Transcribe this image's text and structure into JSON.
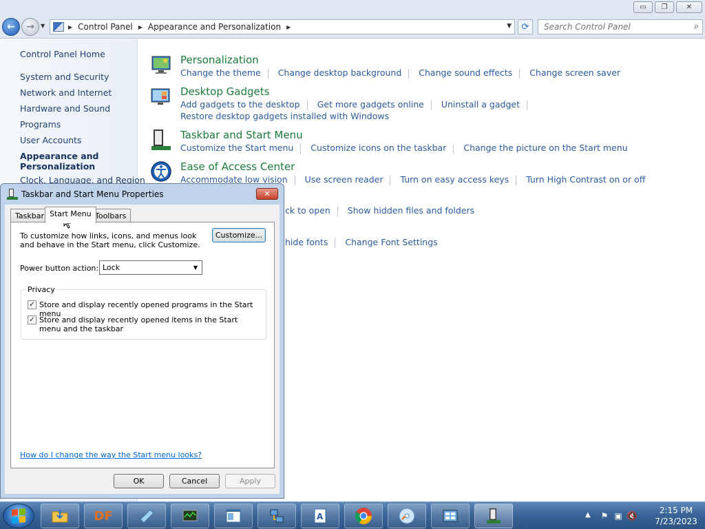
{
  "window": {
    "buttons": {
      "minimize": "▭",
      "restore": "❐",
      "close": "✕"
    }
  },
  "address": {
    "crumbs": [
      "Control Panel",
      "Appearance and Personalization"
    ],
    "search_placeholder": "Search Control Panel"
  },
  "left_pane": {
    "home": "Control Panel Home",
    "items": [
      "System and Security",
      "Network and Internet",
      "Hardware and Sound",
      "Programs",
      "User Accounts"
    ],
    "active_line1": "Appearance and",
    "active_line2": "Personalization",
    "clock_partial": "Clock, Language, and Region"
  },
  "categories": {
    "personalization": {
      "title": "Personalization",
      "links": [
        "Change the theme",
        "Change desktop background",
        "Change sound effects",
        "Change screen saver"
      ]
    },
    "gadgets": {
      "title": "Desktop Gadgets",
      "links": [
        "Add gadgets to the desktop",
        "Get more gadgets online",
        "Uninstall a gadget"
      ],
      "links2": "Restore desktop gadgets installed with Windows"
    },
    "taskbar": {
      "title": "Taskbar and Start Menu",
      "links": [
        "Customize the Start menu",
        "Customize icons on the taskbar",
        "Change the picture on the Start menu"
      ]
    },
    "ease": {
      "title": "Ease of Access Center",
      "links": [
        "Accommodate low vision",
        "Use screen reader",
        "Turn on easy access keys",
        "Turn High Contrast on or off"
      ]
    },
    "folder_partial": {
      "first": "ck to open",
      "second": "Show hidden files and folders"
    },
    "fonts_partial": {
      "first": "hide fonts",
      "second": "Change Font Settings"
    }
  },
  "dialog": {
    "title": "Taskbar and Start Menu Properties",
    "close": "✕",
    "tabs": [
      "Taskbar",
      "Start Menu",
      "Toolbars"
    ],
    "intro": "To customize how links, icons, and menus look and behave in the Start menu, click Customize.",
    "customize_button": "Customize...",
    "power_label": "Power button action:",
    "power_value": "Lock",
    "privacy_label": "Privacy",
    "checkbox1": "Store and display recently opened programs in the Start menu",
    "checkbox2": "Store and display recently opened items in the Start menu and the taskbar",
    "help_link": "How do I change the way the Start menu looks?",
    "ok": "OK",
    "cancel": "Cancel",
    "apply": "Apply"
  },
  "taskbar": {
    "pinned": [
      "explorer",
      "DF",
      "notepad",
      "task-manager",
      "app-window",
      "network",
      "wordpad",
      "chrome",
      "media",
      "control-panel",
      "taskbar-properties"
    ],
    "df_label": "DF",
    "clock_time": "2:15 PM",
    "clock_date": "7/23/2023"
  },
  "colors": {
    "link": "#2a5aa0",
    "category_title": "#1a7a3a",
    "taskbar": "#3a6598"
  }
}
